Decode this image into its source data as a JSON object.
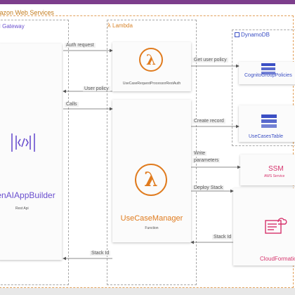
{
  "title": "Amazon Web Services",
  "groups": {
    "apigw": "API Gateway",
    "lambda": "Lambda",
    "dynamodb": "DynamoDB"
  },
  "nodes": {
    "app": {
      "name": "GenAIAppBuilder",
      "sub": "Rest Api"
    },
    "request_processor": {
      "name": "UseCaseRequestProcessorRestAuth"
    },
    "usecase_manager": {
      "name": "UseCaseManager",
      "sub": "Function"
    },
    "cognito_table": {
      "name": "CognitoGroupPolicies"
    },
    "usecases_table": {
      "name": "UseCasesTable"
    },
    "ssm": {
      "name": "SSM",
      "sub": "AWS Service"
    },
    "cloudformation": {
      "name": "CloudFormation"
    }
  },
  "edges": {
    "auth_request": "Auth request",
    "user_policy": "User policy",
    "calls": "Calls",
    "get_user_policy": "Get user policy",
    "create_record": "Create record",
    "write_parameters_1": "Write",
    "write_parameters_2": "parameters",
    "deploy_stack": "Deploy Stack",
    "stack_id_cf": "Stack Id",
    "stack_id_app": "Stack Id"
  },
  "colors": {
    "lambda": "#e07b1e",
    "dynamodb": "#3b4fc4",
    "apigw": "#6a4fcf",
    "ssm": "#d6336c",
    "cloudformation": "#d6336c",
    "aws_border": "#e2a05a",
    "top_bar": "#7d3e8c"
  },
  "icons": {
    "app": "api-gateway-icon",
    "lambda": "lambda-icon",
    "dynamodb": "dynamodb-table-icon",
    "cloudformation": "cloudformation-icon"
  }
}
